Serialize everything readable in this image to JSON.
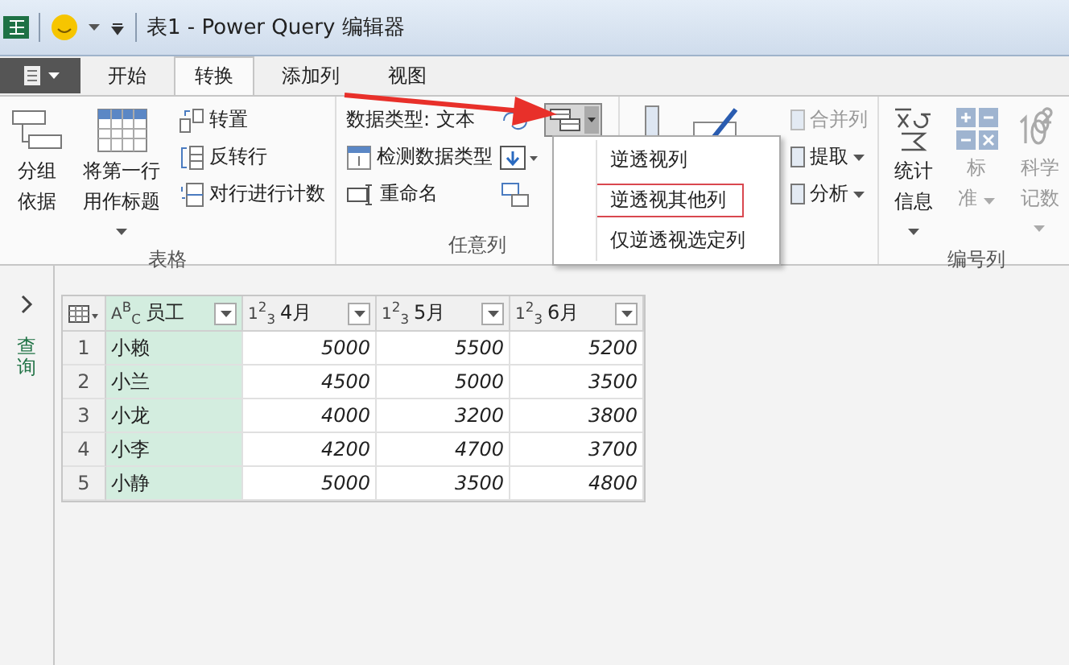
{
  "title_bar": {
    "title": "表1 - Power Query 编辑器"
  },
  "tabs": [
    {
      "label": "开始",
      "selected": false
    },
    {
      "label": "转换",
      "selected": true
    },
    {
      "label": "添加列",
      "selected": false
    },
    {
      "label": "视图",
      "selected": false
    }
  ],
  "table_group": {
    "label": "表格",
    "large_buttons": [
      {
        "kind": "group",
        "lines": [
          "分组",
          "依据"
        ],
        "dropdown": false
      },
      {
        "kind": "header",
        "lines": [
          "将第一行",
          "用作标题"
        ],
        "dropdown": true
      }
    ],
    "small_buttons": [
      {
        "kind": "transpose",
        "label": "转置"
      },
      {
        "kind": "reverse",
        "label": "反转行"
      },
      {
        "kind": "count",
        "label": "对行进行计数"
      }
    ]
  },
  "any_column_group": {
    "label": "任意列",
    "small_buttons": [
      {
        "kind": "type",
        "label": "数据类型: 文本"
      },
      {
        "kind": "detect",
        "label": "检测数据类型"
      },
      {
        "kind": "rename",
        "label": "重命名"
      }
    ]
  },
  "text_group": {
    "small_buttons": [
      {
        "label": "合并列",
        "disabled": true,
        "dropdown": false
      },
      {
        "label": "提取",
        "disabled": false,
        "dropdown": true
      },
      {
        "label": "分析",
        "disabled": false,
        "dropdown": true
      }
    ]
  },
  "number_group": {
    "label": "编号列",
    "buttons": [
      {
        "kind": "stats",
        "lines": [
          "统计",
          "信息"
        ],
        "disabled": false
      },
      {
        "kind": "standard",
        "lines": [
          "标",
          "准"
        ],
        "disabled": true
      },
      {
        "kind": "scientific",
        "lines": [
          "科学",
          "记数"
        ],
        "disabled": true
      }
    ]
  },
  "unpivot_menu": {
    "items": [
      {
        "label": "逆透视列",
        "selected": false
      },
      {
        "label": "逆透视其他列",
        "selected": true
      },
      {
        "label": "仅逆透视选定列",
        "selected": false
      }
    ]
  },
  "sidebar": {
    "label": "查询"
  },
  "table": {
    "columns": [
      {
        "type_label": "A$^{B}$$_{C}$",
        "name": "员工",
        "kind": "text",
        "selected": true
      },
      {
        "type_label": "1$^{2}$$_{3}$",
        "name": "4月",
        "kind": "number",
        "selected": false
      },
      {
        "type_label": "1$^{2}$$_{3}$",
        "name": "5月",
        "kind": "number",
        "selected": false
      },
      {
        "type_label": "1$^{2}$$_{3}$",
        "name": "6月",
        "kind": "number",
        "selected": false
      }
    ],
    "rows": [
      {
        "index": "1",
        "cells": [
          "小赖",
          "5000",
          "5500",
          "5200"
        ]
      },
      {
        "index": "2",
        "cells": [
          "小兰",
          "4500",
          "5000",
          "3500"
        ]
      },
      {
        "index": "3",
        "cells": [
          "小龙",
          "4000",
          "3200",
          "3800"
        ]
      },
      {
        "index": "4",
        "cells": [
          "小李",
          "4200",
          "4700",
          "3700"
        ]
      },
      {
        "index": "5",
        "cells": [
          "小静",
          "5000",
          "3500",
          "4800"
        ]
      }
    ]
  }
}
